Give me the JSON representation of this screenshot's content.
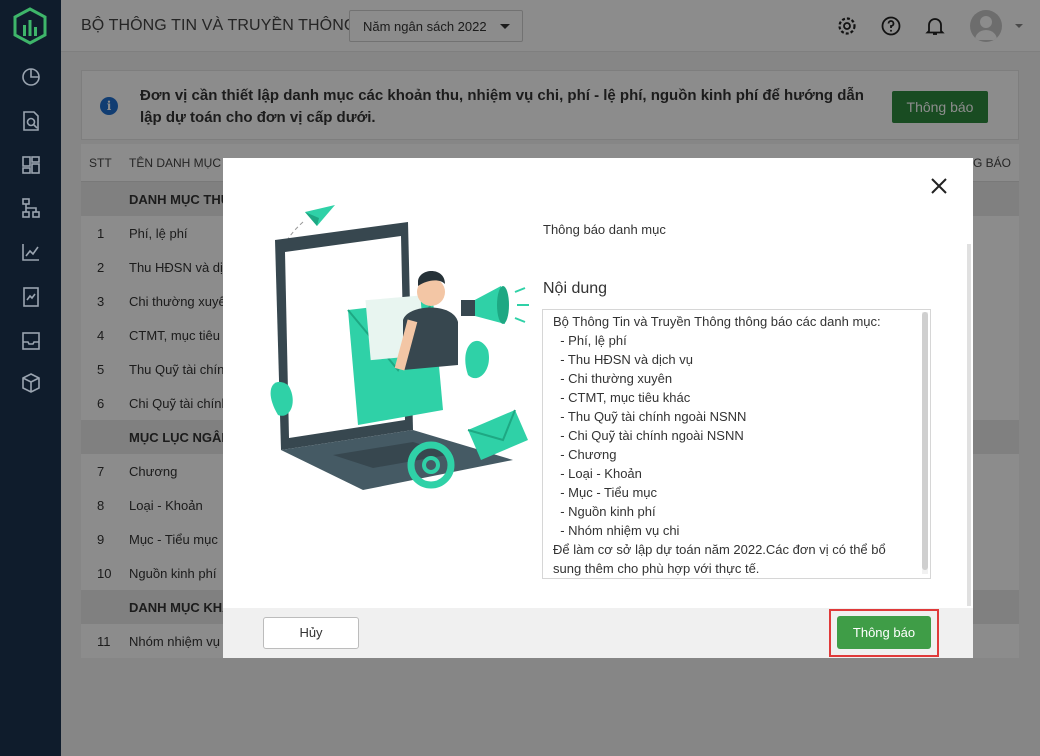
{
  "header": {
    "title": "BỘ THÔNG TIN VÀ TRUYỀN THÔNG",
    "year_select": "Năm ngân sách 2022"
  },
  "notice": {
    "text": "Đơn vị cần thiết lập danh mục các khoản thu, nhiệm vụ chi, phí - lệ phí, nguồn kinh phí để hướng dẫn lập dự toán cho đơn vị cấp dưới.",
    "button": "Thông báo"
  },
  "table": {
    "columns": [
      "STT",
      "TÊN DANH MỤC",
      "G BÁO"
    ],
    "rows": [
      {
        "stt": "",
        "name": "DANH MỤC THU",
        "group": true
      },
      {
        "stt": "1",
        "name": "Phí, lệ phí"
      },
      {
        "stt": "2",
        "name": "Thu HĐSN và dịch"
      },
      {
        "stt": "3",
        "name": "Chi thường xuyên"
      },
      {
        "stt": "4",
        "name": "CTMT, mục tiêu k"
      },
      {
        "stt": "5",
        "name": "Thu Quỹ tài chín"
      },
      {
        "stt": "6",
        "name": "Chi Quỹ tài chính"
      },
      {
        "stt": "",
        "name": "MỤC LỤC NGÂN",
        "group": true
      },
      {
        "stt": "7",
        "name": "Chương"
      },
      {
        "stt": "8",
        "name": "Loại - Khoản"
      },
      {
        "stt": "9",
        "name": "Mục - Tiểu mục"
      },
      {
        "stt": "10",
        "name": "Nguồn kinh phí"
      },
      {
        "stt": "",
        "name": "DANH MỤC KHÁ",
        "group": true
      },
      {
        "stt": "11",
        "name": "Nhóm nhiệm vụ"
      }
    ]
  },
  "modal": {
    "subtitle": "Thông báo danh mục",
    "content_label": "Nội dung",
    "content_lines": [
      "Bộ Thông Tin và Truyền Thông thông báo các danh mục:",
      "  - Phí, lệ phí",
      "  - Thu HĐSN và dịch vụ",
      "  - Chi thường xuyên",
      "  - CTMT, mục tiêu khác",
      "  - Thu Quỹ tài chính ngoài NSNN",
      "  - Chi Quỹ tài chính ngoài NSNN",
      "  - Chương",
      "  - Loại - Khoản",
      "  - Mục - Tiểu mục",
      "  - Nguồn kinh phí",
      "  - Nhóm nhiệm vụ chi",
      "Để làm cơ sở lập dự toán năm 2022.Các đơn vị có thể bổ",
      "sung thêm cho phù hợp với thực tế."
    ],
    "cancel": "Hủy",
    "confirm": "Thông báo"
  },
  "colors": {
    "sidebar": "#0f1c2c",
    "brand_green": "#2e8b3e",
    "teal": "#2fd1a7",
    "highlight": "#e03a3a"
  }
}
